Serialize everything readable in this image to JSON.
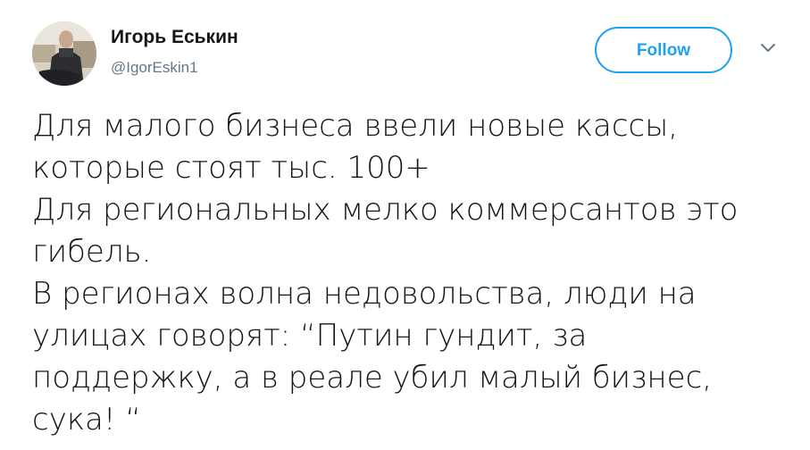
{
  "user": {
    "display_name": "Игорь Еськин",
    "handle": "@IgorEskin1"
  },
  "actions": {
    "follow_label": "Follow",
    "menu_icon": "chevron-down-icon"
  },
  "tweet": {
    "lines": [
      "Для малого бизнеса ввели новые кассы,",
      "которые стоят тыс. 100+",
      "Для региональных мелко коммерсантов это",
      "гибель.",
      "В регионах волна недовольства, люди на",
      "улицах говорят: “Путин гундит, за",
      "поддержку, а в реале убил малый бизнес,",
      "сука! “"
    ]
  },
  "colors": {
    "accent": "#1da1f2",
    "text": "#14171a",
    "secondary": "#657786"
  }
}
